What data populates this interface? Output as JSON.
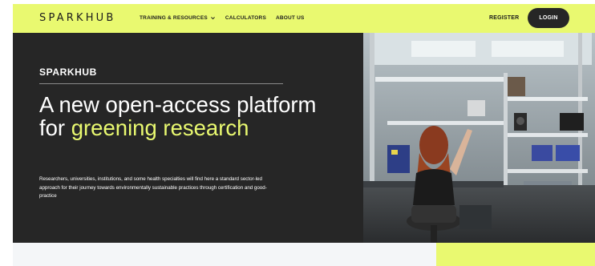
{
  "header": {
    "logo": "SPARKHUB",
    "nav": [
      {
        "label": "TRAINING & RESOURCES",
        "has_dropdown": true
      },
      {
        "label": "CALCULATORS",
        "has_dropdown": false
      },
      {
        "label": "ABOUT US",
        "has_dropdown": false
      }
    ],
    "register_label": "REGISTER",
    "login_label": "LOGIN"
  },
  "hero": {
    "brand": "SPARKHUB",
    "title_plain": "A new open-access platform for",
    "title_accent": "greening research",
    "description": "Researchers, universities, institutions, and some health specialties will find here a standard sector-led approach for their journey towards environmentally sustainable practices through certification and good-practice"
  },
  "colors": {
    "accent": "#e9f970",
    "dark": "#262626",
    "text_light": "#ffffff"
  },
  "icons": {
    "dropdown": "chevron-down-icon"
  }
}
